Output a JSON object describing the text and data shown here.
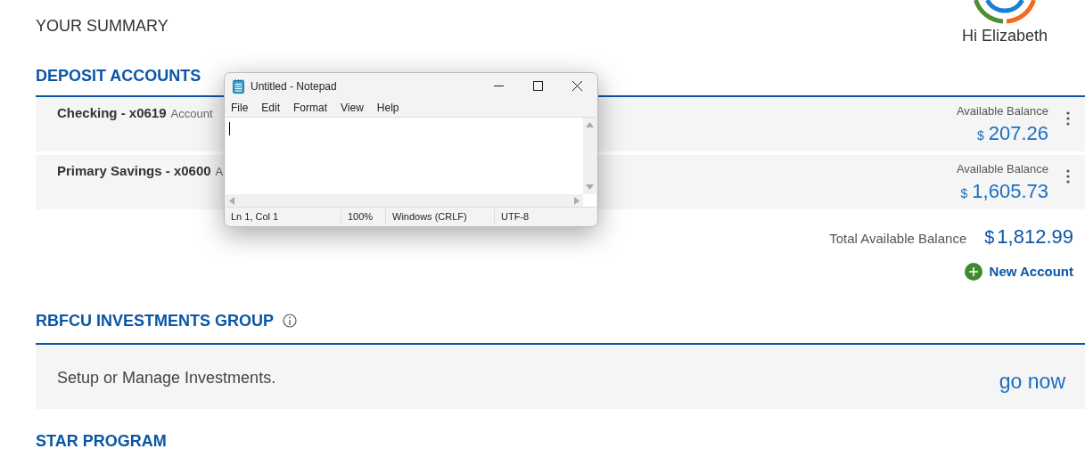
{
  "summary_title": "YOUR SUMMARY",
  "greeting": "Hi Elizabeth",
  "deposit_accounts": {
    "title": "DEPOSIT ACCOUNTS",
    "accounts": [
      {
        "name": "Checking - x0619",
        "descriptor": "Account",
        "balance_label": "Available Balance",
        "currency": "$",
        "balance": "207.26"
      },
      {
        "name": "Primary Savings - x0600",
        "descriptor": "A",
        "balance_label": "Available Balance",
        "currency": "$",
        "balance": "1,605.73"
      }
    ],
    "total_label": "Total Available Balance",
    "total_currency": "$",
    "total": "1,812.99",
    "new_account": "New Account"
  },
  "investments": {
    "title": "RBFCU INVESTMENTS GROUP",
    "text": "Setup or Manage Investments.",
    "link": "go now"
  },
  "star_program": {
    "title": "STAR PROGRAM"
  },
  "notepad": {
    "title": "Untitled - Notepad",
    "menu": [
      "File",
      "Edit",
      "Format",
      "View",
      "Help"
    ],
    "status": [
      "Ln 1, Col 1",
      "100%",
      "Windows (CRLF)",
      "UTF-8"
    ]
  }
}
